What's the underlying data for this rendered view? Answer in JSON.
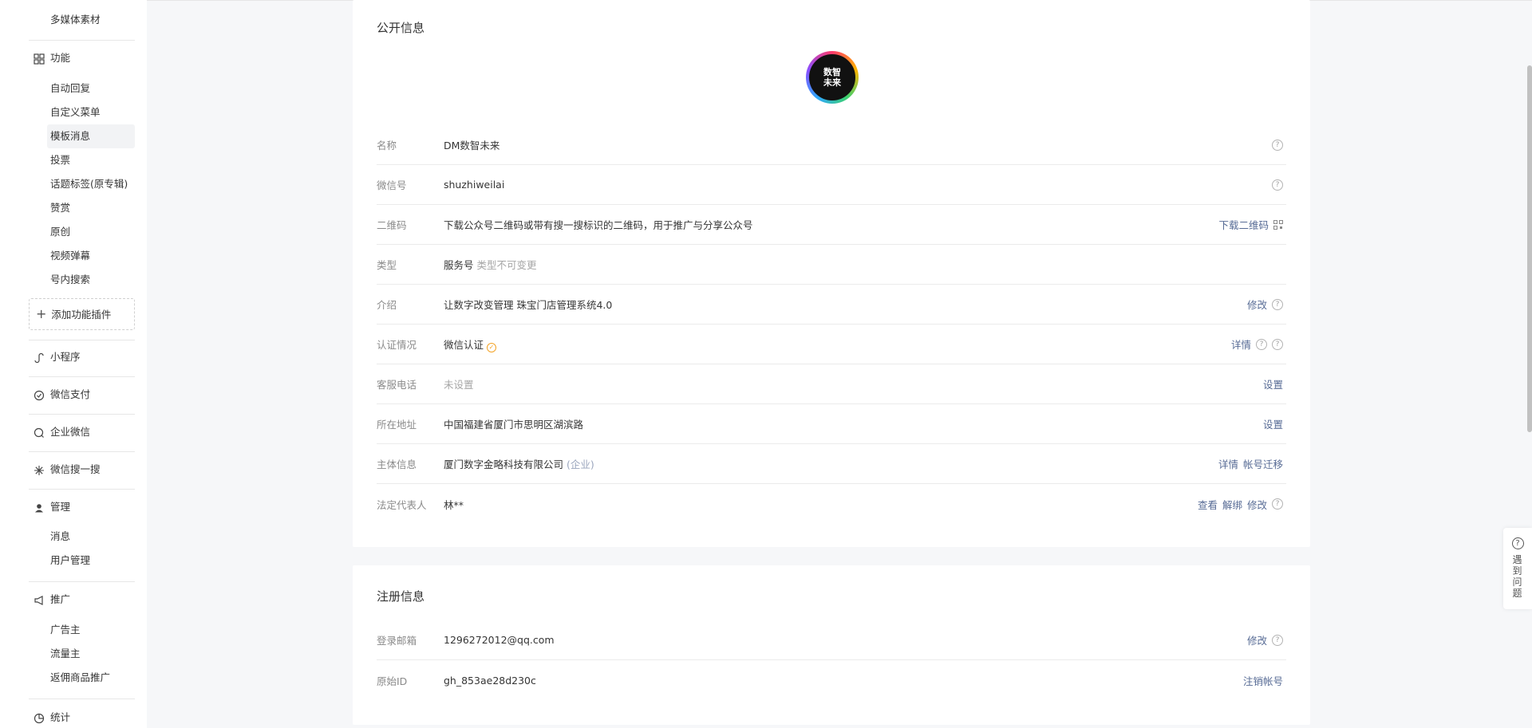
{
  "sidebar": {
    "media": "多媒体素材",
    "features": {
      "label": "功能",
      "items": [
        "自动回复",
        "自定义菜单",
        "模板消息",
        "投票",
        "话题标签(原专辑)",
        "赞赏",
        "原创",
        "视频弹幕",
        "号内搜索"
      ],
      "active": "模板消息",
      "add_plugin": "添加功能插件"
    },
    "miniprogram": "小程序",
    "wechat_pay": "微信支付",
    "wecom": "企业微信",
    "search": "微信搜一搜",
    "manage": {
      "label": "管理",
      "items": [
        "消息",
        "用户管理"
      ]
    },
    "promote": {
      "label": "推广",
      "items": [
        "广告主",
        "流量主",
        "返佣商品推广"
      ]
    },
    "stats": "统计"
  },
  "public_info": {
    "title": "公开信息",
    "avatar_text": "数智\n未来",
    "rows": {
      "name": {
        "label": "名称",
        "value": "DM数智未来"
      },
      "wechat_id": {
        "label": "微信号",
        "value": "shuzhiweilai"
      },
      "qrcode": {
        "label": "二维码",
        "value": "下载公众号二维码或带有搜一搜标识的二维码，用于推广与分享公众号",
        "action": "下载二维码"
      },
      "type": {
        "label": "类型",
        "value": "服务号",
        "note": "类型不可变更"
      },
      "intro": {
        "label": "介绍",
        "value": "让数字改变管理 珠宝门店管理系统4.0",
        "action": "修改"
      },
      "verify": {
        "label": "认证情况",
        "value": "微信认证",
        "action": "详情"
      },
      "phone": {
        "label": "客服电话",
        "value": "未设置",
        "action": "设置"
      },
      "address": {
        "label": "所在地址",
        "value": "中国福建省厦门市思明区湖滨路",
        "action": "设置"
      },
      "entity": {
        "label": "主体信息",
        "value": "厦门数字金略科技有限公司",
        "tag": "(企业)",
        "action1": "详情",
        "action2": "帐号迁移"
      },
      "legal": {
        "label": "法定代表人",
        "value": "林**",
        "action1": "查看",
        "action2": "解绑",
        "action3": "修改"
      }
    }
  },
  "register_info": {
    "title": "注册信息",
    "rows": {
      "email": {
        "label": "登录邮箱",
        "value": "1296272012@qq.com",
        "action": "修改"
      },
      "original_id": {
        "label": "原始ID",
        "value": "gh_853ae28d230c",
        "action": "注销帐号"
      }
    }
  },
  "help_widget": {
    "label": "遇到问题"
  }
}
